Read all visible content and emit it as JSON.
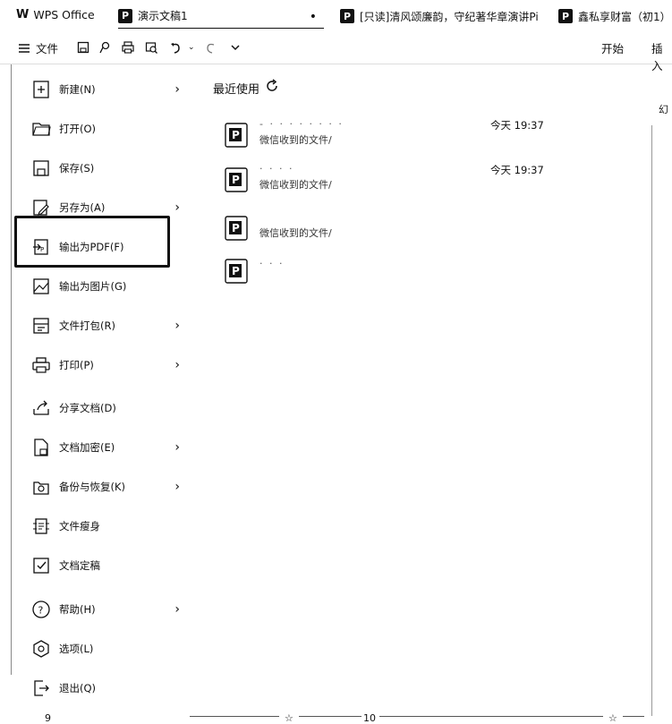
{
  "app": {
    "title": "WPS Office"
  },
  "tabs": [
    {
      "label": "演示文稿1",
      "icon": "p-icon",
      "modified_dot": "•"
    },
    {
      "label": "[只读]清风颂廉韵，守纪著华章演讲Pi",
      "icon": "p-icon"
    },
    {
      "label": "鑫私享财富（初1）",
      "icon": "p-icon"
    }
  ],
  "toolbar": {
    "file_label": "文件",
    "start_label": "开始",
    "insert_label": "插入"
  },
  "menu": {
    "items": [
      {
        "label": "新建(N)",
        "icon": "new-icon",
        "has_arrow": true
      },
      {
        "label": "打开(O)",
        "icon": "folder-icon",
        "has_arrow": false
      },
      {
        "label": "保存(S)",
        "icon": "save-icon",
        "has_arrow": false
      },
      {
        "label": "另存为(A)",
        "icon": "save-as-icon",
        "has_arrow": true
      },
      {
        "label": "输出为PDF(F)",
        "icon": "pdf-icon",
        "has_arrow": false
      },
      {
        "label": "输出为图片(G)",
        "icon": "image-icon",
        "has_arrow": false
      },
      {
        "label": "文件打包(R)",
        "icon": "package-icon",
        "has_arrow": true
      },
      {
        "label": "打印(P)",
        "icon": "printer-icon",
        "has_arrow": true
      },
      {
        "label": "分享文档(D)",
        "icon": "share-icon",
        "has_arrow": false
      },
      {
        "label": "文档加密(E)",
        "icon": "encrypt-icon",
        "has_arrow": true
      },
      {
        "label": "备份与恢复(K)",
        "icon": "backup-icon",
        "has_arrow": true
      },
      {
        "label": "文件瘦身",
        "icon": "slim-icon",
        "has_arrow": false
      },
      {
        "label": "文档定稿",
        "icon": "finalize-icon",
        "has_arrow": false
      },
      {
        "label": "帮助(H)",
        "icon": "help-icon",
        "has_arrow": true
      },
      {
        "label": "选项(L)",
        "icon": "options-icon",
        "has_arrow": false
      },
      {
        "label": "退出(Q)",
        "icon": "exit-icon",
        "has_arrow": false
      }
    ],
    "arrow": "›"
  },
  "recent": {
    "title": "最近使用",
    "files": [
      {
        "name": "- · · · ·  ·  ·  ·  ·",
        "path": "微信收到的文件/",
        "time": "今天 19:37"
      },
      {
        "name": "·  · · ·",
        "path": "微信收到的文件/",
        "time": "今天 19:37"
      },
      {
        "name": "",
        "path": "微信收到的文件/",
        "time": ""
      },
      {
        "name": "· · ·",
        "path": "",
        "time": ""
      }
    ]
  },
  "right_label": "幻",
  "bottom": {
    "left_num": "9",
    "mid_num": "10"
  },
  "colors": {
    "accent": "#111111",
    "background": "#ffffff"
  }
}
